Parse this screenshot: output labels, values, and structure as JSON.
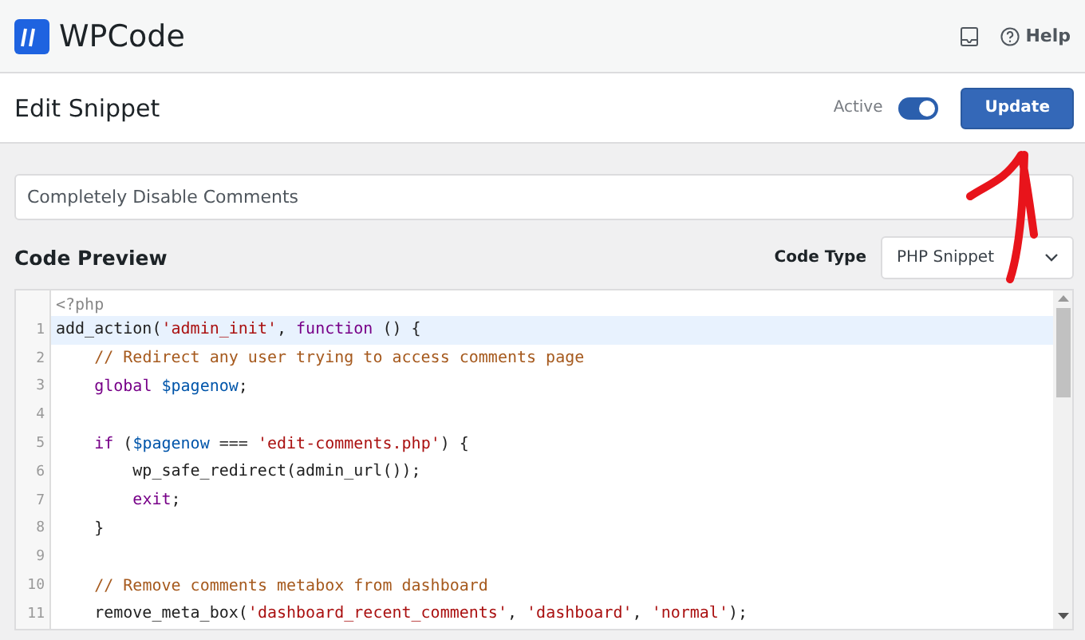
{
  "topbar": {
    "logo_text": "WPCode",
    "help_label": "Help"
  },
  "header": {
    "title": "Edit Snippet",
    "active_label": "Active",
    "active": true,
    "update_button": "Update"
  },
  "snippet_title": {
    "value": "Completely Disable Comments"
  },
  "code_preview": {
    "label": "Code Preview",
    "code_type_label": "Code Type",
    "code_type_value": "PHP Snippet"
  },
  "editor": {
    "open_tag": "<?php",
    "lines": [
      {
        "number": "1",
        "text": "add_action('admin_init', function () {",
        "active": true
      },
      {
        "number": "2",
        "text": "    // Redirect any user trying to access comments page",
        "active": false
      },
      {
        "number": "3",
        "text": "    global $pagenow;",
        "active": false
      },
      {
        "number": "4",
        "active": false
      },
      {
        "number": "5",
        "text": "    if ($pagenow === 'edit-comments.php') {",
        "active": false
      },
      {
        "number": "6",
        "text": "        wp_safe_redirect(admin_url());",
        "active": false
      },
      {
        "number": "7",
        "text": "        exit;",
        "active": false
      },
      {
        "number": "8",
        "text": "    }",
        "active": false
      },
      {
        "number": "9",
        "active": false
      },
      {
        "number": "10",
        "text": "    // Remove comments metabox from dashboard",
        "active": false
      },
      {
        "number": "11",
        "text": "    remove_meta_box('dashboard_recent_comments', 'dashboard', 'normal');",
        "active": false
      }
    ]
  }
}
